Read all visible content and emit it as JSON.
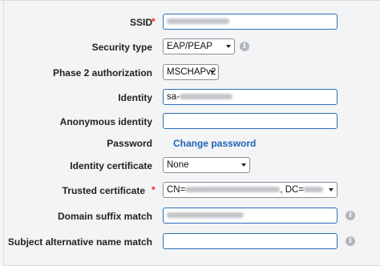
{
  "form": {
    "ssid": {
      "label": "SSID",
      "required": "*"
    },
    "security_type": {
      "label": "Security type",
      "value": "EAP/PEAP"
    },
    "phase2": {
      "label": "Phase 2 authorization",
      "value": "MSCHAPv2"
    },
    "identity": {
      "label": "Identity",
      "prefix": "sa-"
    },
    "anonymous_identity": {
      "label": "Anonymous identity",
      "value": ""
    },
    "password": {
      "label": "Password",
      "link": "Change password"
    },
    "identity_certificate": {
      "label": "Identity certificate",
      "value": "None"
    },
    "trusted_certificate": {
      "label": "Trusted certificate",
      "required": "*",
      "cn_prefix": "CN=",
      "dc_prefix": ", DC="
    },
    "domain_suffix": {
      "label": "Domain suffix match"
    },
    "subject_alt_name": {
      "label": "Subject alternative name match",
      "value": ""
    }
  },
  "icons": {
    "info": "info-icon",
    "info_glyph": "i"
  },
  "colors": {
    "required": "#e0301e",
    "link": "#1f63b5",
    "focus_border": "#2a6fb8"
  }
}
